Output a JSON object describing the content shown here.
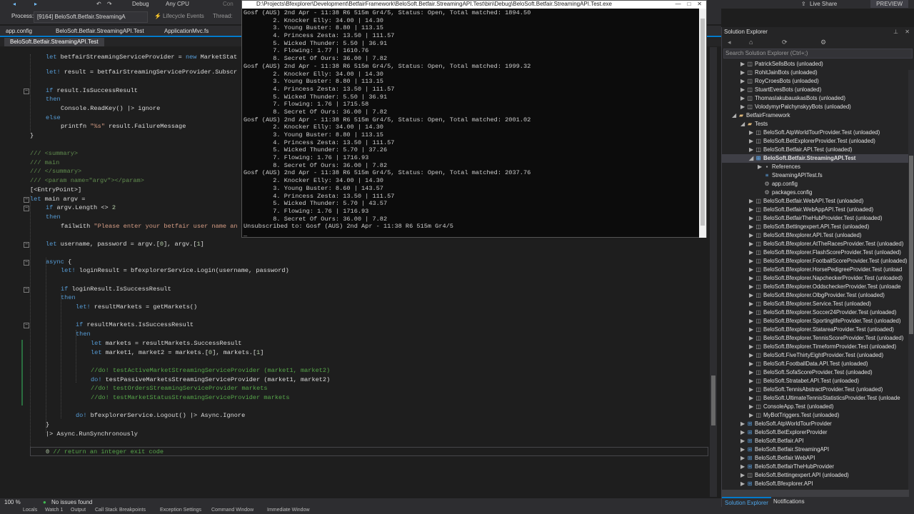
{
  "topbar": {
    "continue_label": "Con",
    "debug_config": "Debug",
    "platform": "Any CPU",
    "live_share": "Live Share",
    "preview": "PREVIEW"
  },
  "procbar": {
    "process_label": "Process:",
    "process_value": "[9164] BeloSoft.Betfair.StreamingA",
    "lifecycle": "Lifecycle Events",
    "thread": "Thread:"
  },
  "tabs": [
    "app.config",
    "BeloSoft.Betfair.StreamingAPI.Test",
    "ApplicationMvc.fs"
  ],
  "file_tab": "BeloSoft.Betfair.StreamingAPI.Test",
  "code_lines": [
    {
      "indent": 64,
      "parts": [
        [
          "kw",
          "let "
        ],
        [
          "",
          "betfairStreamingServiceProvider = "
        ],
        [
          "kw",
          "new "
        ],
        [
          "",
          "MarketStat"
        ]
      ]
    },
    {
      "indent": 64,
      "parts": [
        [
          "kw",
          "let! "
        ],
        [
          "",
          "result = betfairStreamingServiceProvider.Subscr"
        ]
      ]
    },
    {
      "indent": 64,
      "parts": [
        [
          "kw",
          "if "
        ],
        [
          "",
          "result.IsSuccessResult"
        ]
      ]
    },
    {
      "indent": 64,
      "parts": [
        [
          "kw",
          "then"
        ]
      ]
    },
    {
      "indent": 85,
      "parts": [
        [
          "",
          "Console.ReadKey() |> ignore"
        ]
      ]
    },
    {
      "indent": 64,
      "parts": [
        [
          "kw",
          "else"
        ]
      ]
    },
    {
      "indent": 85,
      "parts": [
        [
          "",
          "printfn "
        ],
        [
          "str",
          "\"%s\""
        ],
        [
          "",
          " result.FailureMessage"
        ]
      ]
    },
    {
      "indent": 42,
      "parts": [
        [
          "",
          "}"
        ]
      ]
    },
    {
      "indent": 42,
      "parts": [
        [
          "doc",
          "/// <summary>"
        ]
      ]
    },
    {
      "indent": 42,
      "parts": [
        [
          "doc",
          "/// main"
        ]
      ]
    },
    {
      "indent": 42,
      "parts": [
        [
          "doc",
          "/// </summary>"
        ]
      ]
    },
    {
      "indent": 42,
      "parts": [
        [
          "doc",
          "/// <param name=\"argv\"></param>"
        ]
      ]
    },
    {
      "indent": 42,
      "parts": [
        [
          "",
          "[<EntryPoint>]"
        ]
      ]
    },
    {
      "indent": 42,
      "parts": [
        [
          "kw",
          "let "
        ],
        [
          "",
          "main argv ="
        ]
      ]
    },
    {
      "indent": 64,
      "parts": [
        [
          "kw",
          "if "
        ],
        [
          "",
          "argv.Length <> "
        ],
        [
          "num",
          "2"
        ]
      ]
    },
    {
      "indent": 64,
      "parts": [
        [
          "kw",
          "then"
        ]
      ]
    },
    {
      "indent": 85,
      "parts": [
        [
          "",
          "failwith "
        ],
        [
          "str",
          "\"Please enter your betfair user name an"
        ]
      ]
    },
    {
      "indent": 64,
      "parts": [
        [
          "kw",
          "let "
        ],
        [
          "",
          "username, password = argv.["
        ],
        [
          "num",
          "0"
        ],
        [
          "",
          "], argv.["
        ],
        [
          "num",
          "1"
        ],
        [
          "",
          "]"
        ]
      ]
    },
    {
      "indent": 64,
      "parts": [
        [
          "kw",
          "async "
        ],
        [
          "",
          "{"
        ]
      ]
    },
    {
      "indent": 85,
      "parts": [
        [
          "kw",
          "let! "
        ],
        [
          "",
          "loginResult = bfexplorerService.Login(username, password)"
        ]
      ]
    },
    {
      "indent": 85,
      "parts": [
        [
          "kw",
          "if "
        ],
        [
          "",
          "loginResult.IsSuccessResult"
        ]
      ]
    },
    {
      "indent": 85,
      "parts": [
        [
          "kw",
          "then"
        ]
      ]
    },
    {
      "indent": 106,
      "parts": [
        [
          "kw",
          "let! "
        ],
        [
          "",
          "resultMarkets = getMarkets()"
        ]
      ]
    },
    {
      "indent": 106,
      "parts": [
        [
          "kw",
          "if "
        ],
        [
          "",
          "resultMarkets.IsSuccessResult"
        ]
      ]
    },
    {
      "indent": 106,
      "parts": [
        [
          "kw",
          "then"
        ]
      ]
    },
    {
      "indent": 127,
      "parts": [
        [
          "kw",
          "let "
        ],
        [
          "",
          "markets = resultMarkets.SuccessResult"
        ]
      ]
    },
    {
      "indent": 127,
      "parts": [
        [
          "kw",
          "let "
        ],
        [
          "",
          "market1, market2 = markets.["
        ],
        [
          "num",
          "0"
        ],
        [
          "",
          "], markets.["
        ],
        [
          "num",
          "1"
        ],
        [
          "",
          "]"
        ]
      ]
    },
    {
      "indent": 127,
      "parts": [
        [
          "cmt",
          "//do! testActiveMarketStreamingServiceProvider (market1, market2)"
        ]
      ]
    },
    {
      "indent": 127,
      "parts": [
        [
          "kw",
          "do! "
        ],
        [
          "",
          "testPassiveMarketsStreamingServiceProvider (market1, market2)"
        ]
      ]
    },
    {
      "indent": 127,
      "parts": [
        [
          "cmt",
          "//do! testOrdersStreamingServiceProvider markets"
        ]
      ]
    },
    {
      "indent": 127,
      "parts": [
        [
          "cmt",
          "//do! testMarketStatusStreamingServiceProvider markets"
        ]
      ]
    },
    {
      "indent": 106,
      "parts": [
        [
          "kw",
          "do! "
        ],
        [
          "",
          "bfexplorerService.Logout() |> Async.Ignore"
        ]
      ]
    },
    {
      "indent": 64,
      "parts": [
        [
          "",
          "}"
        ]
      ]
    },
    {
      "indent": 64,
      "parts": [
        [
          "",
          "|> Async.RunSynchronously"
        ]
      ]
    },
    {
      "indent": 64,
      "parts": [
        [
          "num",
          "0 "
        ],
        [
          "cmt",
          "// return an integer exit code"
        ]
      ]
    }
  ],
  "console": {
    "title": "D:\\Projects\\Bfexplorer\\Development\\BetfairFramework\\BeloSoft.Betfair.StreamingAPI.Test\\bin\\Debug\\BeloSoft.Betfair.StreamingAPI.Test.exe",
    "lines": [
      "Gosf (AUS) 2nd Apr - 11:38 R6 515m Gr4/5, Status: Open, Total matched: 1894.50",
      "        2. Knocker Elly: 34.00 | 14.30",
      "        3. Young Buster: 8.80 | 113.15",
      "        4. Princess Zesta: 13.50 | 111.57",
      "        5. Wicked Thunder: 5.50 | 36.91",
      "        7. Flowing: 1.77 | 1610.76",
      "        8. Secret Of Ours: 36.00 | 7.82",
      "Gosf (AUS) 2nd Apr - 11:38 R6 515m Gr4/5, Status: Open, Total matched: 1999.32",
      "        2. Knocker Elly: 34.00 | 14.30",
      "        3. Young Buster: 8.80 | 113.15",
      "        4. Princess Zesta: 13.50 | 111.57",
      "        5. Wicked Thunder: 5.50 | 36.91",
      "        7. Flowing: 1.76 | 1715.58",
      "        8. Secret Of Ours: 36.00 | 7.82",
      "Gosf (AUS) 2nd Apr - 11:38 R6 515m Gr4/5, Status: Open, Total matched: 2001.02",
      "        2. Knocker Elly: 34.00 | 14.30",
      "        3. Young Buster: 8.80 | 113.15",
      "        4. Princess Zesta: 13.50 | 111.57",
      "        5. Wicked Thunder: 5.70 | 37.26",
      "        7. Flowing: 1.76 | 1716.93",
      "        8. Secret Of Ours: 36.00 | 7.82",
      "Gosf (AUS) 2nd Apr - 11:38 R6 515m Gr4/5, Status: Open, Total matched: 2037.76",
      "        2. Knocker Elly: 34.00 | 14.30",
      "        3. Young Buster: 8.60 | 143.57",
      "        4. Princess Zesta: 13.50 | 111.57",
      "        5. Wicked Thunder: 5.70 | 43.57",
      "        7. Flowing: 1.76 | 1716.93",
      "        8. Secret Of Ours: 36.00 | 7.82",
      "Unsubscribed to: Gosf (AUS) 2nd Apr - 11:38 R6 515m Gr4/5",
      "_"
    ]
  },
  "solution_explorer": {
    "title": "Solution Explorer",
    "search_placeholder": "Search Solution Explorer (Ctrl+;)",
    "items": [
      {
        "level": 2,
        "caret": "▶",
        "icon": "proj",
        "label": "PatrickSellsBots (unloaded)"
      },
      {
        "level": 2,
        "caret": "▶",
        "icon": "proj",
        "label": "RohitJainBots (unloaded)"
      },
      {
        "level": 2,
        "caret": "▶",
        "icon": "proj",
        "label": "RoyCroesBots (unloaded)"
      },
      {
        "level": 2,
        "caret": "▶",
        "icon": "proj",
        "label": "StuartEvesBots (unloaded)"
      },
      {
        "level": 2,
        "caret": "▶",
        "icon": "proj",
        "label": "ThomasIakubauskasBots (unloaded)"
      },
      {
        "level": 2,
        "caret": "▶",
        "icon": "proj",
        "label": "VolodymyrPalchynskyyBots (unloaded)"
      },
      {
        "level": 1,
        "caret": "◢",
        "icon": "folder",
        "label": "BetfairFramework"
      },
      {
        "level": 2,
        "caret": "◢",
        "icon": "folder",
        "label": "Tests"
      },
      {
        "level": 3,
        "caret": "▶",
        "icon": "proj",
        "label": "BeloSoft.AtpWorldTourProvider.Test (unloaded)"
      },
      {
        "level": 3,
        "caret": "▶",
        "icon": "proj",
        "label": "BeloSoft.BetExplorerProvider.Test (unloaded)"
      },
      {
        "level": 3,
        "caret": "▶",
        "icon": "proj",
        "label": "BeloSoft.Betfair.API.Test (unloaded)"
      },
      {
        "level": 3,
        "caret": "◢",
        "icon": "fs",
        "label": "BeloSoft.Betfair.StreamingAPI.Test",
        "selected": true
      },
      {
        "level": 4,
        "caret": "▶",
        "icon": "ref",
        "label": "References"
      },
      {
        "level": 4,
        "caret": "",
        "icon": "fsfile",
        "label": "StreamingAPITest.fs"
      },
      {
        "level": 4,
        "caret": "",
        "icon": "cfg",
        "label": "app.config"
      },
      {
        "level": 4,
        "caret": "",
        "icon": "cfg",
        "label": "packages.config"
      },
      {
        "level": 3,
        "caret": "▶",
        "icon": "proj",
        "label": "BeloSoft.Betfair.WebAPI.Test (unloaded)"
      },
      {
        "level": 3,
        "caret": "▶",
        "icon": "proj",
        "label": "BeloSoft.Betfair.WebAppAPI.Test (unloaded)"
      },
      {
        "level": 3,
        "caret": "▶",
        "icon": "proj",
        "label": "BeloSoft.BetfairTheHubProvider.Test (unloaded)"
      },
      {
        "level": 3,
        "caret": "▶",
        "icon": "proj",
        "label": "BeloSoft.Bettingexpert.API.Test (unloaded)"
      },
      {
        "level": 3,
        "caret": "▶",
        "icon": "proj",
        "label": "BeloSoft.Bfexplorer.API.Test (unloaded)"
      },
      {
        "level": 3,
        "caret": "▶",
        "icon": "proj",
        "label": "BeloSoft.Bfexplorer.AtTheRacesProvider.Test (unloaded)"
      },
      {
        "level": 3,
        "caret": "▶",
        "icon": "proj",
        "label": "BeloSoft.Bfexplorer.FlashScoreProvider.Test (unloaded)"
      },
      {
        "level": 3,
        "caret": "▶",
        "icon": "proj",
        "label": "BeloSoft.Bfexplorer.FootballScoreProvider.Test (unloaded)"
      },
      {
        "level": 3,
        "caret": "▶",
        "icon": "proj",
        "label": "BeloSoft.Bfexplorer.HorsePedigreeProvider.Test (unload"
      },
      {
        "level": 3,
        "caret": "▶",
        "icon": "proj",
        "label": "BeloSoft.Bfexplorer.NapcheckerProvider.Test (unloaded)"
      },
      {
        "level": 3,
        "caret": "▶",
        "icon": "proj",
        "label": "BeloSoft.Bfexplorer.OddscheckerProvider.Test (unloade"
      },
      {
        "level": 3,
        "caret": "▶",
        "icon": "proj",
        "label": "BeloSoft.Bfexplorer.OlbgProvider.Test (unloaded)"
      },
      {
        "level": 3,
        "caret": "▶",
        "icon": "proj",
        "label": "BeloSoft.Bfexplorer.Service.Test (unloaded)"
      },
      {
        "level": 3,
        "caret": "▶",
        "icon": "proj",
        "label": "BeloSoft.Bfexplorer.Soccer24Provider.Test (unloaded)"
      },
      {
        "level": 3,
        "caret": "▶",
        "icon": "proj",
        "label": "BeloSoft.Bfexplorer.SportinglifeProvider.Test (unloaded)"
      },
      {
        "level": 3,
        "caret": "▶",
        "icon": "proj",
        "label": "BeloSoft.Bfexplorer.StatareaProvider.Test (unloaded)"
      },
      {
        "level": 3,
        "caret": "▶",
        "icon": "proj",
        "label": "BeloSoft.Bfexplorer.TennisScoreProvider.Test (unloaded)"
      },
      {
        "level": 3,
        "caret": "▶",
        "icon": "proj",
        "label": "BeloSoft.Bfexplorer.TimeformProvider.Test (unloaded)"
      },
      {
        "level": 3,
        "caret": "▶",
        "icon": "proj",
        "label": "BeloSoft.FiveThirtyEightProvider.Test (unloaded)"
      },
      {
        "level": 3,
        "caret": "▶",
        "icon": "proj",
        "label": "BeloSoft.FootballData.API.Test (unloaded)"
      },
      {
        "level": 3,
        "caret": "▶",
        "icon": "proj",
        "label": "BeloSoft.SofaScoreProvider.Test (unloaded)"
      },
      {
        "level": 3,
        "caret": "▶",
        "icon": "proj",
        "label": "BeloSoft.Stratabet.API.Test (unloaded)"
      },
      {
        "level": 3,
        "caret": "▶",
        "icon": "proj",
        "label": "BeloSoft.TennisAbstractProvider.Test (unloaded)"
      },
      {
        "level": 3,
        "caret": "▶",
        "icon": "proj",
        "label": "BeloSoft.UltimateTennisStatisticsProvider.Test (unloade"
      },
      {
        "level": 3,
        "caret": "▶",
        "icon": "proj",
        "label": "ConsoleApp.Test (unloaded)"
      },
      {
        "level": 3,
        "caret": "▶",
        "icon": "proj",
        "label": "MyBotTriggers.Test (unloaded)"
      },
      {
        "level": 2,
        "caret": "▶",
        "icon": "fs",
        "label": "BeloSoft.AtpWorldTourProvider"
      },
      {
        "level": 2,
        "caret": "▶",
        "icon": "fs",
        "label": "BeloSoft.BetExplorerProvider"
      },
      {
        "level": 2,
        "caret": "▶",
        "icon": "fs",
        "label": "BeloSoft.Betfair.API"
      },
      {
        "level": 2,
        "caret": "▶",
        "icon": "fs",
        "label": "BeloSoft.Betfair.StreamingAPI"
      },
      {
        "level": 2,
        "caret": "▶",
        "icon": "fs",
        "label": "BeloSoft.Betfair.WebAPI"
      },
      {
        "level": 2,
        "caret": "▶",
        "icon": "fs",
        "label": "BeloSoft.BetfairTheHubProvider"
      },
      {
        "level": 2,
        "caret": "▶",
        "icon": "proj",
        "label": "BeloSoft.Bettingexpert.API (unloaded)"
      },
      {
        "level": 2,
        "caret": "▶",
        "icon": "fs",
        "label": "BeloSoft.Bfexplorer.API"
      }
    ],
    "bottom_tabs": [
      "Solution Explorer",
      "Notifications"
    ]
  },
  "status": {
    "zoom": "100 %",
    "issues": "No issues found"
  },
  "bottom_tool_tabs": [
    "Locals",
    "Watch 1",
    "Output",
    "Call Stack",
    "Breakpoints",
    "Exception Settings",
    "Command Window",
    "Immediate Window"
  ],
  "colors": {
    "accent": "#007acc",
    "editor_bg": "#1e1e1e",
    "console_bg": "#0c0c0c",
    "keyword": "#569cd6",
    "comment": "#57a64a"
  }
}
